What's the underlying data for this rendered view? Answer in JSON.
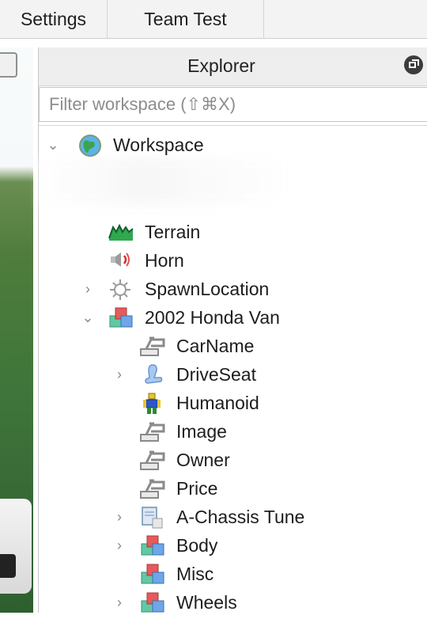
{
  "tabs": {
    "settings": "Settings",
    "team_test": "Team Test"
  },
  "explorer": {
    "title": "Explorer",
    "filter_placeholder": "Filter workspace (⇧⌘X)"
  },
  "tree": [
    {
      "label": "Workspace",
      "icon": "globe-icon",
      "depth": 0,
      "chevron": "expanded"
    },
    {
      "label": "Terrain",
      "icon": "terrain-icon",
      "depth": 1,
      "chevron": "none"
    },
    {
      "label": "Horn",
      "icon": "sound-icon",
      "depth": 1,
      "chevron": "none"
    },
    {
      "label": "SpawnLocation",
      "icon": "spawn-icon",
      "depth": 1,
      "chevron": "collapsed"
    },
    {
      "label": "2002 Honda Van",
      "icon": "model-icon",
      "depth": 1,
      "chevron": "expanded"
    },
    {
      "label": "CarName",
      "icon": "value-icon",
      "depth": 2,
      "chevron": "none"
    },
    {
      "label": "DriveSeat",
      "icon": "seat-icon",
      "depth": 2,
      "chevron": "collapsed"
    },
    {
      "label": "Humanoid",
      "icon": "humanoid-icon",
      "depth": 2,
      "chevron": "none"
    },
    {
      "label": "Image",
      "icon": "value-icon",
      "depth": 2,
      "chevron": "none"
    },
    {
      "label": "Owner",
      "icon": "value-icon",
      "depth": 2,
      "chevron": "none"
    },
    {
      "label": "Price",
      "icon": "value-icon",
      "depth": 2,
      "chevron": "none"
    },
    {
      "label": "A-Chassis Tune",
      "icon": "script-module-icon",
      "depth": 2,
      "chevron": "collapsed"
    },
    {
      "label": "Body",
      "icon": "model-icon",
      "depth": 2,
      "chevron": "collapsed"
    },
    {
      "label": "Misc",
      "icon": "model-icon",
      "depth": 2,
      "chevron": "none"
    },
    {
      "label": "Wheels",
      "icon": "model-icon",
      "depth": 2,
      "chevron": "collapsed"
    }
  ]
}
